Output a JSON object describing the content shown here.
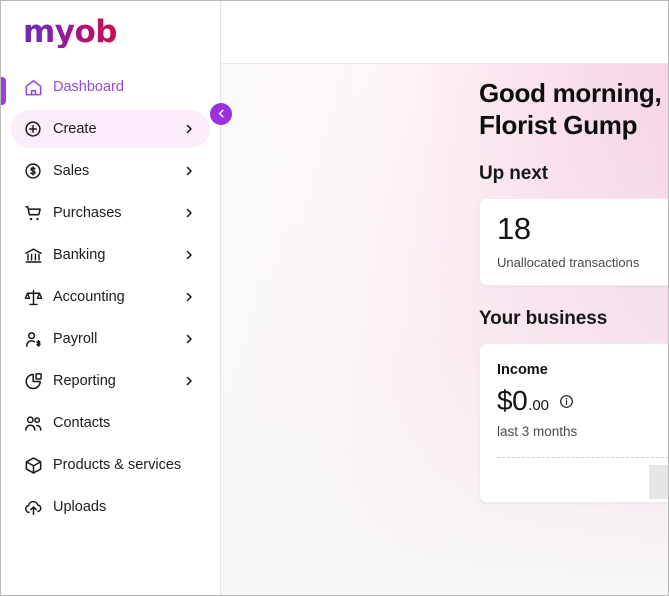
{
  "brand": {
    "logo_text": "myob",
    "accent_purple": "#9B3FE0",
    "accent_pink_bg": "#fbeefa",
    "logo_gradient_start": "#6B2DB5",
    "logo_gradient_end": "#CC0E52"
  },
  "sidebar": {
    "collapse_button_label": "Collapse navigation",
    "items": [
      {
        "label": "Dashboard",
        "icon": "home-icon",
        "has_chevron": false,
        "active": true,
        "highlight": false
      },
      {
        "label": "Create",
        "icon": "plus-circle-icon",
        "has_chevron": true,
        "active": false,
        "highlight": true
      },
      {
        "label": "Sales",
        "icon": "dollar-circle-icon",
        "has_chevron": true,
        "active": false,
        "highlight": false
      },
      {
        "label": "Purchases",
        "icon": "shopping-cart-icon",
        "has_chevron": true,
        "active": false,
        "highlight": false
      },
      {
        "label": "Banking",
        "icon": "bank-icon",
        "has_chevron": true,
        "active": false,
        "highlight": false
      },
      {
        "label": "Accounting",
        "icon": "scales-icon",
        "has_chevron": true,
        "active": false,
        "highlight": false
      },
      {
        "label": "Payroll",
        "icon": "person-dollar-icon",
        "has_chevron": true,
        "active": false,
        "highlight": false
      },
      {
        "label": "Reporting",
        "icon": "pie-chart-icon",
        "has_chevron": true,
        "active": false,
        "highlight": false
      },
      {
        "label": "Contacts",
        "icon": "people-icon",
        "has_chevron": false,
        "active": false,
        "highlight": false
      },
      {
        "label": "Products & services",
        "icon": "cube-icon",
        "has_chevron": false,
        "active": false,
        "highlight": false
      },
      {
        "label": "Uploads",
        "icon": "upload-cloud-icon",
        "has_chevron": false,
        "active": false,
        "highlight": false
      }
    ]
  },
  "main": {
    "greeting": "Good morning, Florist Gump",
    "up_next": {
      "section_title": "Up next",
      "count": "18",
      "description": "Unallocated transactions",
      "chevron_icon": "chevron-right-icon"
    },
    "your_business": {
      "section_title": "Your business",
      "income": {
        "title": "Income",
        "amount_dollars": "$0",
        "amount_cents": ".00",
        "info_icon": "info-circle-icon",
        "period": "last 3 months"
      }
    }
  }
}
